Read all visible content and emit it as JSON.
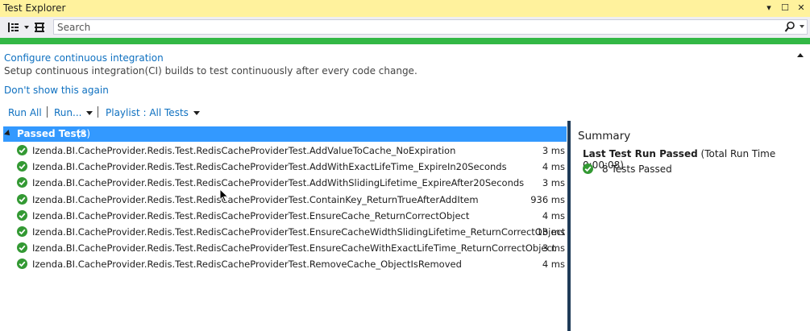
{
  "window": {
    "title": "Test Explorer",
    "controls": [
      "▾",
      "☐",
      "✕"
    ]
  },
  "toolbar": {
    "search_placeholder": "Search"
  },
  "ci_banner": {
    "link": "Configure continuous integration",
    "description": "Setup continuous integration(CI) builds to test continuously after every code change.",
    "dismiss": "Don't show this again"
  },
  "commands": {
    "run_all": "Run All",
    "run": "Run...",
    "playlist": "Playlist : All Tests"
  },
  "group": {
    "title": "Passed Tests",
    "count": "(8)"
  },
  "tests": [
    {
      "name": "Izenda.BI.CacheProvider.Redis.Test.RedisCacheProviderTest.AddValueToCache_NoExpiration",
      "time": "3 ms"
    },
    {
      "name": "Izenda.BI.CacheProvider.Redis.Test.RedisCacheProviderTest.AddWithExactLifeTime_ExpireIn20Seconds",
      "time": "4 ms"
    },
    {
      "name": "Izenda.BI.CacheProvider.Redis.Test.RedisCacheProviderTest.AddWithSlidingLifetime_ExpireAfter20Seconds",
      "time": "3 ms"
    },
    {
      "name": "Izenda.BI.CacheProvider.Redis.Test.RedisCacheProviderTest.ContainKey_ReturnTrueAfterAddItem",
      "time": "936 ms"
    },
    {
      "name": "Izenda.BI.CacheProvider.Redis.Test.RedisCacheProviderTest.EnsureCache_ReturnCorrectObject",
      "time": "4 ms"
    },
    {
      "name": "Izenda.BI.CacheProvider.Redis.Test.RedisCacheProviderTest.EnsureCacheWidthSlidingLifetime_ReturnCorrectObject",
      "time": "13 ms"
    },
    {
      "name": "Izenda.BI.CacheProvider.Redis.Test.RedisCacheProviderTest.EnsureCacheWithExactLifeTime_ReturnCorrectObject",
      "time": "3 ms"
    },
    {
      "name": "Izenda.BI.CacheProvider.Redis.Test.RedisCacheProviderTest.RemoveCache_ObjectIsRemoved",
      "time": "4 ms"
    }
  ],
  "summary": {
    "title": "Summary",
    "last_run_label": "Last Test Run Passed",
    "total_time": "(Total Run Time 0:00:08)",
    "passed_count": "8 Tests Passed"
  },
  "colors": {
    "title_bar": "#fff29d",
    "progress_pass": "#33b845",
    "selection": "#3399ff",
    "link": "#0e70c0",
    "pass_icon": "#339933"
  }
}
